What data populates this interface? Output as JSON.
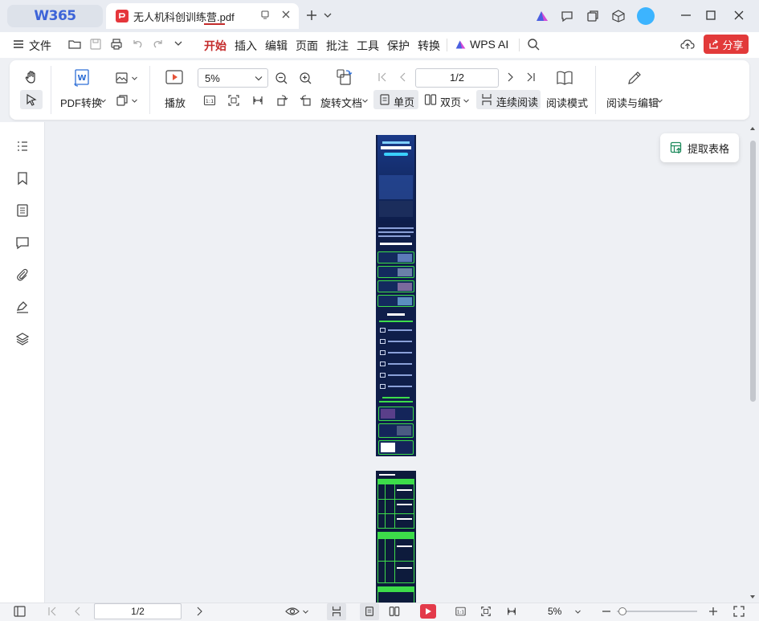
{
  "app": {
    "brand": "W365"
  },
  "tab": {
    "filename": "无人机科创训练营.pdf"
  },
  "menu": {
    "file": "文件",
    "items": [
      "开始",
      "插入",
      "编辑",
      "页面",
      "批注",
      "工具",
      "保护",
      "转换",
      "WPS AI"
    ],
    "share": "分享"
  },
  "toolbar": {
    "pdf_convert": "PDF转换",
    "play": "播放",
    "zoom_value": "5%",
    "rotate_doc": "旋转文档",
    "page_value": "1/2",
    "single_page": "单页",
    "double_page": "双页",
    "continuous": "连续阅读",
    "read_mode": "阅读模式",
    "read_edit": "阅读与编辑"
  },
  "float": {
    "extract_table": "提取表格"
  },
  "statusbar": {
    "page_value": "1/2",
    "zoom_value": "5%"
  },
  "colors": {
    "accent": "#c42b2b",
    "share_bg": "#e23a3a",
    "page_bg": "#0f1e4a",
    "neon": "#3ddc4a"
  }
}
